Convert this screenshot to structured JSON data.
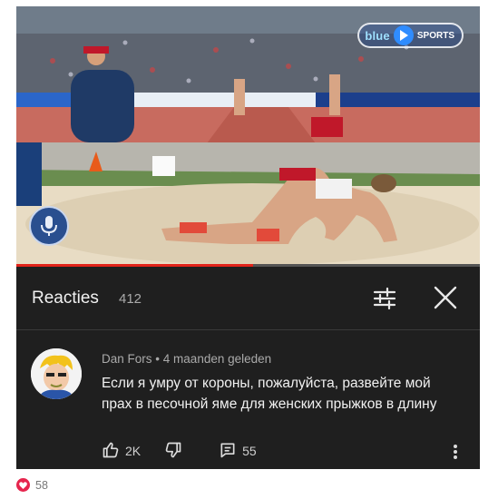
{
  "video": {
    "brand": "blue",
    "badge": "SPORTS",
    "progress": 0.51,
    "channel_logo_icon": "microphone-icon"
  },
  "reactions": {
    "title": "Reacties",
    "count": "412",
    "sort_icon": "sliders-icon",
    "close_icon": "close-icon"
  },
  "comment": {
    "author": "Dan Fors",
    "separator": "•",
    "time": "4 maanden geleden",
    "text": "Если я умру от короны, пожалуйста, развейте мой прах в песочной яме для женских прыжков в длину",
    "likes": "2K",
    "replies": "55",
    "like_icon": "thumbs-up-icon",
    "dislike_icon": "thumbs-down-icon",
    "reply_icon": "reply-icon",
    "more_icon": "more-vertical-icon"
  },
  "post": {
    "likes": "58",
    "like_icon": "heart-icon"
  },
  "colors": {
    "panel": "#1f1f1f",
    "progress": "#e2231a",
    "heart": "#e6254d"
  }
}
